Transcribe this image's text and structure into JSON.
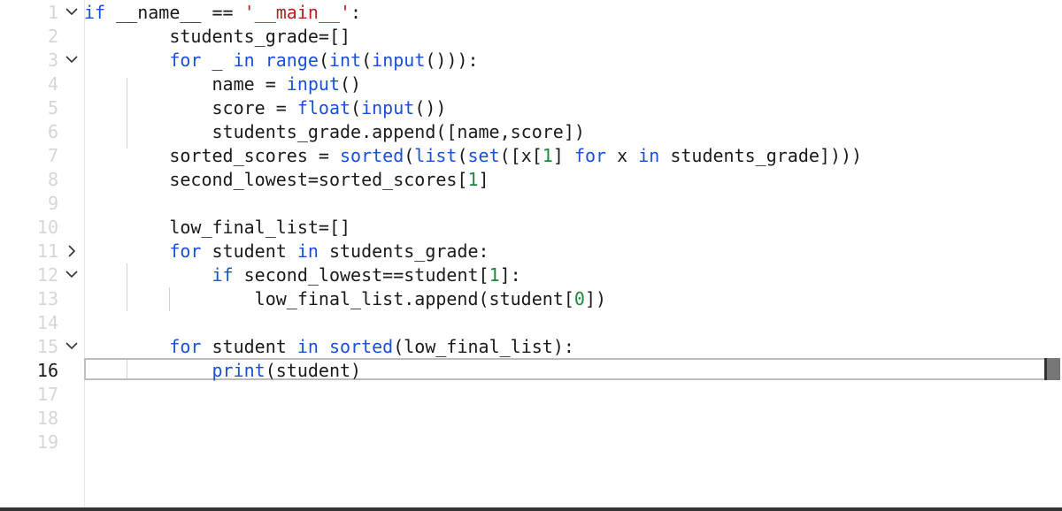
{
  "editor": {
    "current_line": 16,
    "lines": [
      {
        "num": "1",
        "fold": "down",
        "tokens": [
          [
            "kw",
            "if "
          ],
          [
            "plain",
            "__name__ "
          ],
          [
            "op",
            "== "
          ],
          [
            "str",
            "'__main__'"
          ],
          [
            "plain",
            ":"
          ]
        ]
      },
      {
        "num": "2",
        "fold": "",
        "tokens": [
          [
            "plain",
            "        students_grade=[]"
          ]
        ]
      },
      {
        "num": "3",
        "fold": "down",
        "tokens": [
          [
            "plain",
            "        "
          ],
          [
            "kw",
            "for"
          ],
          [
            "plain",
            " _ "
          ],
          [
            "kw",
            "in"
          ],
          [
            "plain",
            " "
          ],
          [
            "fn",
            "range"
          ],
          [
            "plain",
            "("
          ],
          [
            "fn",
            "int"
          ],
          [
            "plain",
            "("
          ],
          [
            "fn",
            "input"
          ],
          [
            "plain",
            "())):"
          ]
        ]
      },
      {
        "num": "4",
        "fold": "",
        "tokens": [
          [
            "plain",
            "            name = "
          ],
          [
            "fn",
            "input"
          ],
          [
            "plain",
            "()"
          ]
        ]
      },
      {
        "num": "5",
        "fold": "",
        "tokens": [
          [
            "plain",
            "            score = "
          ],
          [
            "fn",
            "float"
          ],
          [
            "plain",
            "("
          ],
          [
            "fn",
            "input"
          ],
          [
            "plain",
            "())"
          ]
        ]
      },
      {
        "num": "6",
        "fold": "",
        "tokens": [
          [
            "plain",
            "            students_grade.append([name,score])"
          ]
        ]
      },
      {
        "num": "7",
        "fold": "",
        "tokens": [
          [
            "plain",
            "        sorted_scores = "
          ],
          [
            "fn",
            "sorted"
          ],
          [
            "plain",
            "("
          ],
          [
            "fn",
            "list"
          ],
          [
            "plain",
            "("
          ],
          [
            "fn",
            "set"
          ],
          [
            "plain",
            "([x["
          ],
          [
            "num",
            "1"
          ],
          [
            "plain",
            "] "
          ],
          [
            "kw",
            "for"
          ],
          [
            "plain",
            " x "
          ],
          [
            "kw",
            "in"
          ],
          [
            "plain",
            " students_grade])))"
          ]
        ]
      },
      {
        "num": "8",
        "fold": "",
        "tokens": [
          [
            "plain",
            "        second_lowest=sorted_scores["
          ],
          [
            "num",
            "1"
          ],
          [
            "plain",
            "]"
          ]
        ]
      },
      {
        "num": "9",
        "fold": "",
        "tokens": [
          [
            "plain",
            ""
          ]
        ]
      },
      {
        "num": "10",
        "fold": "",
        "tokens": [
          [
            "plain",
            "        low_final_list=[]"
          ]
        ]
      },
      {
        "num": "11",
        "fold": "right",
        "tokens": [
          [
            "plain",
            "        "
          ],
          [
            "kw",
            "for"
          ],
          [
            "plain",
            " student "
          ],
          [
            "kw",
            "in"
          ],
          [
            "plain",
            " students_grade:"
          ]
        ]
      },
      {
        "num": "12",
        "fold": "down",
        "tokens": [
          [
            "plain",
            "            "
          ],
          [
            "kw",
            "if"
          ],
          [
            "plain",
            " second_lowest==student["
          ],
          [
            "num",
            "1"
          ],
          [
            "plain",
            "]:"
          ]
        ]
      },
      {
        "num": "13",
        "fold": "",
        "tokens": [
          [
            "plain",
            "                low_final_list.append(student["
          ],
          [
            "num",
            "0"
          ],
          [
            "plain",
            "])"
          ]
        ]
      },
      {
        "num": "14",
        "fold": "",
        "tokens": [
          [
            "plain",
            ""
          ]
        ]
      },
      {
        "num": "15",
        "fold": "down",
        "tokens": [
          [
            "plain",
            "        "
          ],
          [
            "kw",
            "for"
          ],
          [
            "plain",
            " student "
          ],
          [
            "kw",
            "in"
          ],
          [
            "plain",
            " "
          ],
          [
            "fn",
            "sorted"
          ],
          [
            "plain",
            "(low_final_list):"
          ]
        ]
      },
      {
        "num": "16",
        "fold": "",
        "tokens": [
          [
            "plain",
            "            "
          ],
          [
            "fn",
            "print"
          ],
          [
            "plain",
            "(student)"
          ]
        ]
      },
      {
        "num": "17",
        "fold": "",
        "tokens": [
          [
            "plain",
            ""
          ]
        ]
      },
      {
        "num": "18",
        "fold": "",
        "tokens": [
          [
            "plain",
            ""
          ]
        ]
      },
      {
        "num": "19",
        "fold": "",
        "tokens": [
          [
            "plain",
            ""
          ]
        ]
      }
    ]
  },
  "colors": {
    "keyword": "#1a4fd8",
    "string": "#b02020",
    "number": "#1b8a3a",
    "text": "#1a1a1a",
    "gutter_dim": "#d6d6d6"
  }
}
